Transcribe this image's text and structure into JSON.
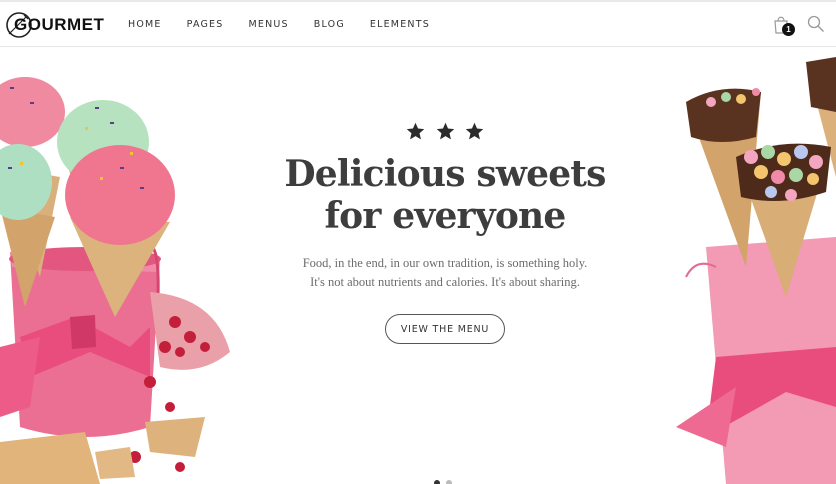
{
  "brand": {
    "name": "GOURMET"
  },
  "nav": {
    "items": [
      {
        "label": "HOME"
      },
      {
        "label": "PAGES"
      },
      {
        "label": "MENUS"
      },
      {
        "label": "BLOG"
      },
      {
        "label": "ELEMENTS"
      }
    ]
  },
  "cart": {
    "count": "1",
    "icon": "shopping-bag-icon"
  },
  "search": {
    "icon": "search-icon"
  },
  "hero": {
    "rating_stars": 3,
    "headline_line1": "Delicious sweets",
    "headline_line2": "for everyone",
    "subtext_line1": "Food, in the end, in our own tradition, is something holy.",
    "subtext_line2": "It's not about nutrients and calories. It's about sharing.",
    "cta_label": "VIEW THE MENU",
    "slides_total": 2,
    "slide_active": 1
  },
  "colors": {
    "accent_pink": "#e8527a",
    "text_dark": "#3d3d3d",
    "text_muted": "#6b6b6b"
  }
}
